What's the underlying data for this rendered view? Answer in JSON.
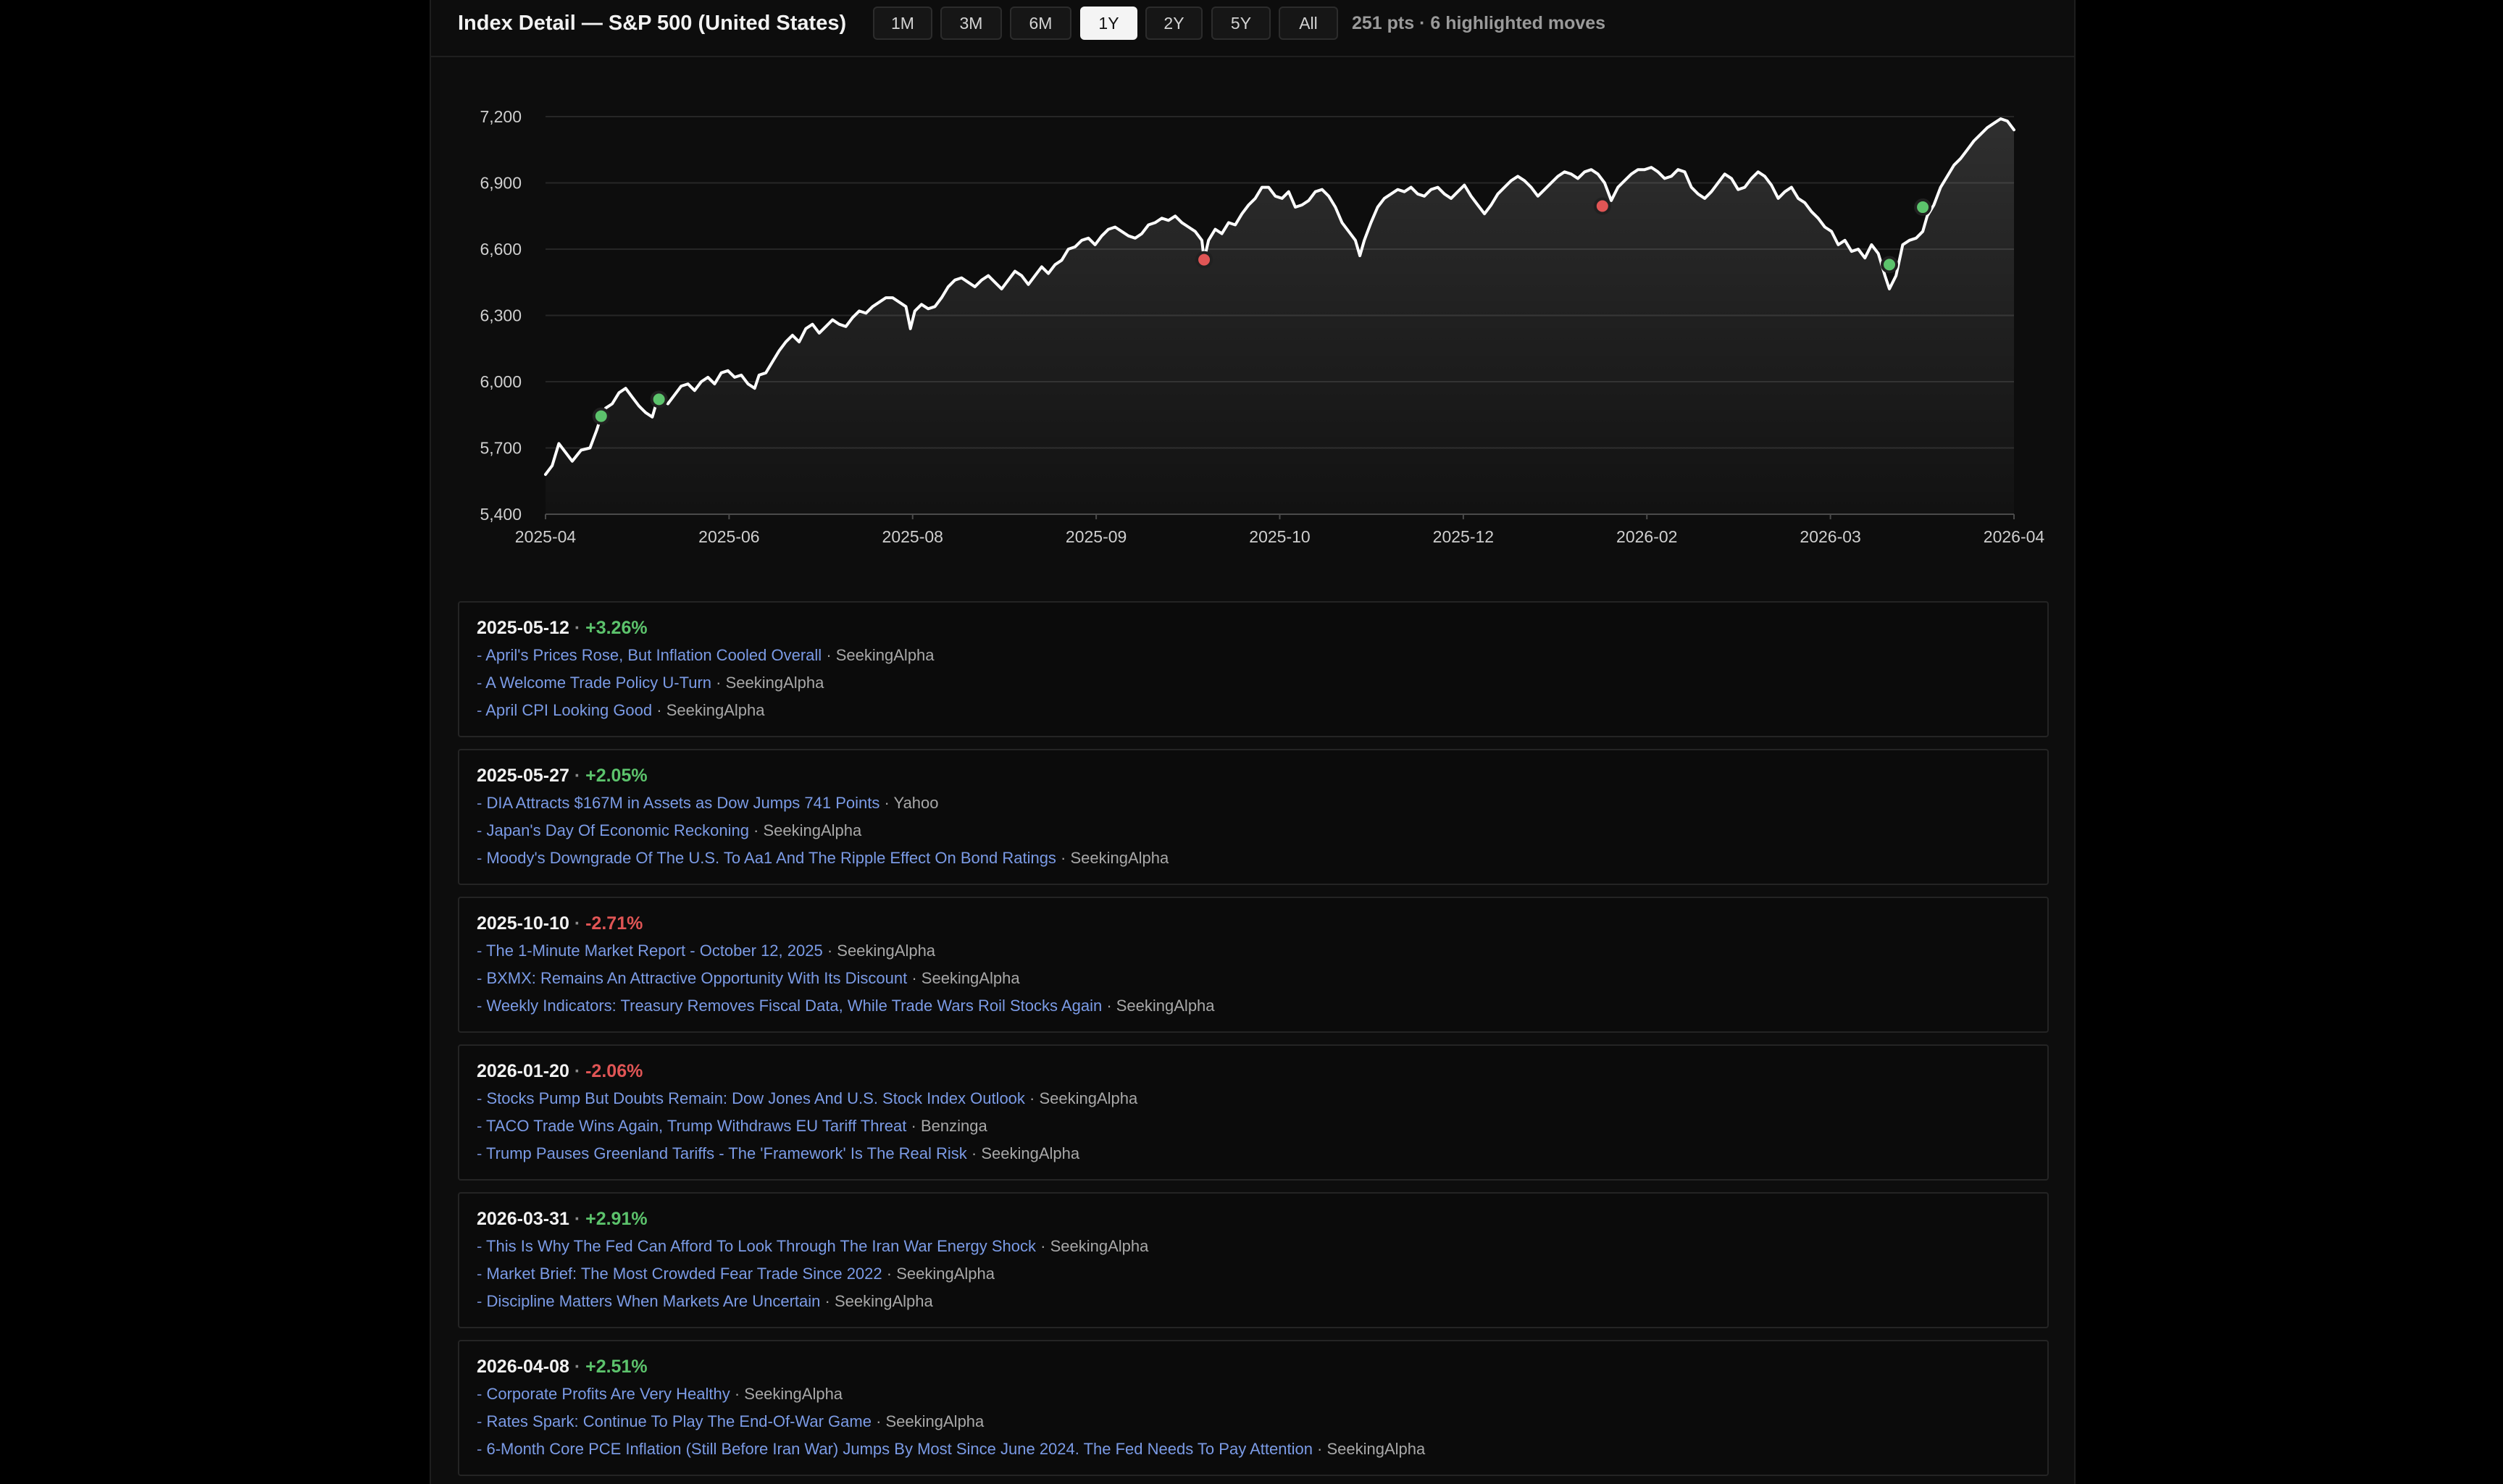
{
  "header": {
    "title": "Index Detail — S&P 500 (United States)",
    "ranges": [
      "1M",
      "3M",
      "6M",
      "1Y",
      "2Y",
      "5Y",
      "All"
    ],
    "active_range": "1Y",
    "summary": "251 pts · 6 highlighted moves"
  },
  "colors": {
    "up": "#5cc36c",
    "down": "#e05555",
    "line": "#ffffff",
    "link": "#7b9be6"
  },
  "chart_data": {
    "type": "line",
    "series": [
      {
        "values": [
          [
            0,
            5580
          ],
          [
            0.3,
            5620
          ],
          [
            0.6,
            5720
          ],
          [
            0.9,
            5680
          ],
          [
            1.2,
            5640
          ],
          [
            1.6,
            5690
          ],
          [
            2.0,
            5700
          ],
          [
            2.3,
            5780
          ],
          [
            2.5,
            5844
          ],
          [
            2.7,
            5880
          ],
          [
            3.0,
            5900
          ],
          [
            3.3,
            5950
          ],
          [
            3.6,
            5970
          ],
          [
            3.9,
            5930
          ],
          [
            4.2,
            5890
          ],
          [
            4.5,
            5860
          ],
          [
            4.8,
            5840
          ],
          [
            5.0,
            5910
          ],
          [
            5.2,
            5920
          ],
          [
            5.5,
            5900
          ],
          [
            5.8,
            5940
          ],
          [
            6.1,
            5980
          ],
          [
            6.4,
            5990
          ],
          [
            6.7,
            5960
          ],
          [
            7.0,
            6000
          ],
          [
            7.3,
            6020
          ],
          [
            7.6,
            5990
          ],
          [
            7.9,
            6040
          ],
          [
            8.2,
            6050
          ],
          [
            8.5,
            6020
          ],
          [
            8.8,
            6030
          ],
          [
            9.1,
            5990
          ],
          [
            9.4,
            5970
          ],
          [
            9.6,
            6030
          ],
          [
            9.9,
            6040
          ],
          [
            10.2,
            6090
          ],
          [
            10.5,
            6140
          ],
          [
            10.8,
            6180
          ],
          [
            11.1,
            6210
          ],
          [
            11.4,
            6180
          ],
          [
            11.7,
            6240
          ],
          [
            12.0,
            6260
          ],
          [
            12.3,
            6220
          ],
          [
            12.6,
            6250
          ],
          [
            12.9,
            6280
          ],
          [
            13.2,
            6260
          ],
          [
            13.5,
            6250
          ],
          [
            13.8,
            6290
          ],
          [
            14.1,
            6320
          ],
          [
            14.4,
            6310
          ],
          [
            14.7,
            6340
          ],
          [
            15.0,
            6360
          ],
          [
            15.3,
            6380
          ],
          [
            15.6,
            6380
          ],
          [
            15.9,
            6360
          ],
          [
            16.2,
            6340
          ],
          [
            16.4,
            6240
          ],
          [
            16.6,
            6320
          ],
          [
            16.9,
            6350
          ],
          [
            17.2,
            6330
          ],
          [
            17.5,
            6340
          ],
          [
            17.8,
            6380
          ],
          [
            18.1,
            6430
          ],
          [
            18.4,
            6460
          ],
          [
            18.7,
            6470
          ],
          [
            19.0,
            6450
          ],
          [
            19.3,
            6430
          ],
          [
            19.6,
            6460
          ],
          [
            19.9,
            6480
          ],
          [
            20.2,
            6450
          ],
          [
            20.5,
            6420
          ],
          [
            20.8,
            6460
          ],
          [
            21.1,
            6500
          ],
          [
            21.4,
            6480
          ],
          [
            21.7,
            6440
          ],
          [
            22.0,
            6480
          ],
          [
            22.3,
            6520
          ],
          [
            22.6,
            6490
          ],
          [
            22.9,
            6530
          ],
          [
            23.2,
            6550
          ],
          [
            23.5,
            6600
          ],
          [
            23.8,
            6610
          ],
          [
            24.1,
            6640
          ],
          [
            24.4,
            6650
          ],
          [
            24.7,
            6620
          ],
          [
            25.0,
            6660
          ],
          [
            25.3,
            6690
          ],
          [
            25.6,
            6700
          ],
          [
            25.9,
            6680
          ],
          [
            26.2,
            6660
          ],
          [
            26.5,
            6650
          ],
          [
            26.8,
            6670
          ],
          [
            27.1,
            6710
          ],
          [
            27.4,
            6720
          ],
          [
            27.7,
            6740
          ],
          [
            28.0,
            6730
          ],
          [
            28.3,
            6750
          ],
          [
            28.6,
            6720
          ],
          [
            28.9,
            6700
          ],
          [
            29.2,
            6680
          ],
          [
            29.5,
            6640
          ],
          [
            29.6,
            6552
          ],
          [
            29.8,
            6640
          ],
          [
            30.1,
            6690
          ],
          [
            30.4,
            6670
          ],
          [
            30.7,
            6720
          ],
          [
            31.0,
            6710
          ],
          [
            31.3,
            6760
          ],
          [
            31.6,
            6800
          ],
          [
            31.9,
            6830
          ],
          [
            32.2,
            6880
          ],
          [
            32.5,
            6880
          ],
          [
            32.8,
            6840
          ],
          [
            33.1,
            6830
          ],
          [
            33.4,
            6860
          ],
          [
            33.7,
            6790
          ],
          [
            34.0,
            6800
          ],
          [
            34.3,
            6820
          ],
          [
            34.6,
            6860
          ],
          [
            34.9,
            6870
          ],
          [
            35.2,
            6840
          ],
          [
            35.5,
            6790
          ],
          [
            35.8,
            6720
          ],
          [
            36.1,
            6680
          ],
          [
            36.4,
            6640
          ],
          [
            36.6,
            6570
          ],
          [
            36.8,
            6640
          ],
          [
            37.1,
            6720
          ],
          [
            37.4,
            6790
          ],
          [
            37.7,
            6830
          ],
          [
            38.0,
            6850
          ],
          [
            38.3,
            6870
          ],
          [
            38.6,
            6860
          ],
          [
            38.9,
            6880
          ],
          [
            39.2,
            6850
          ],
          [
            39.5,
            6840
          ],
          [
            39.8,
            6870
          ],
          [
            40.1,
            6880
          ],
          [
            40.4,
            6850
          ],
          [
            40.7,
            6830
          ],
          [
            41.0,
            6860
          ],
          [
            41.3,
            6890
          ],
          [
            41.6,
            6840
          ],
          [
            41.9,
            6800
          ],
          [
            42.2,
            6760
          ],
          [
            42.5,
            6800
          ],
          [
            42.8,
            6850
          ],
          [
            43.1,
            6880
          ],
          [
            43.4,
            6910
          ],
          [
            43.7,
            6930
          ],
          [
            44.0,
            6910
          ],
          [
            44.3,
            6880
          ],
          [
            44.6,
            6840
          ],
          [
            44.9,
            6870
          ],
          [
            45.2,
            6900
          ],
          [
            45.5,
            6930
          ],
          [
            45.8,
            6950
          ],
          [
            46.1,
            6940
          ],
          [
            46.4,
            6920
          ],
          [
            46.7,
            6950
          ],
          [
            47.0,
            6960
          ],
          [
            47.3,
            6940
          ],
          [
            47.6,
            6900
          ],
          [
            47.9,
            6820
          ],
          [
            48.2,
            6880
          ],
          [
            48.5,
            6910
          ],
          [
            48.8,
            6940
          ],
          [
            49.1,
            6960
          ],
          [
            49.4,
            6960
          ],
          [
            49.7,
            6970
          ],
          [
            50.0,
            6950
          ],
          [
            50.3,
            6920
          ],
          [
            50.6,
            6930
          ],
          [
            50.9,
            6960
          ],
          [
            51.2,
            6950
          ],
          [
            51.5,
            6880
          ],
          [
            51.8,
            6850
          ],
          [
            52.1,
            6830
          ],
          [
            52.4,
            6860
          ],
          [
            52.7,
            6900
          ],
          [
            53.0,
            6940
          ],
          [
            53.3,
            6920
          ],
          [
            53.6,
            6870
          ],
          [
            53.9,
            6880
          ],
          [
            54.2,
            6920
          ],
          [
            54.5,
            6950
          ],
          [
            54.8,
            6930
          ],
          [
            55.1,
            6890
          ],
          [
            55.4,
            6830
          ],
          [
            55.7,
            6860
          ],
          [
            56.0,
            6880
          ],
          [
            56.3,
            6830
          ],
          [
            56.6,
            6810
          ],
          [
            56.9,
            6770
          ],
          [
            57.2,
            6740
          ],
          [
            57.5,
            6700
          ],
          [
            57.8,
            6680
          ],
          [
            58.1,
            6620
          ],
          [
            58.4,
            6640
          ],
          [
            58.7,
            6590
          ],
          [
            59.0,
            6600
          ],
          [
            59.3,
            6560
          ],
          [
            59.6,
            6620
          ],
          [
            59.9,
            6580
          ],
          [
            60.2,
            6480
          ],
          [
            60.4,
            6420
          ],
          [
            60.7,
            6480
          ],
          [
            61.0,
            6620
          ],
          [
            61.3,
            6640
          ],
          [
            61.6,
            6650
          ],
          [
            61.9,
            6680
          ],
          [
            62.1,
            6750
          ],
          [
            62.4,
            6800
          ],
          [
            62.7,
            6880
          ],
          [
            63.0,
            6930
          ],
          [
            63.3,
            6980
          ],
          [
            63.6,
            7010
          ],
          [
            63.9,
            7050
          ],
          [
            64.2,
            7090
          ],
          [
            64.5,
            7120
          ],
          [
            64.8,
            7150
          ],
          [
            65.1,
            7170
          ],
          [
            65.4,
            7190
          ],
          [
            65.7,
            7180
          ],
          [
            66.0,
            7140
          ]
        ]
      }
    ],
    "x_ticks": [
      "2025-04",
      "2025-06",
      "2025-08",
      "2025-09",
      "2025-10",
      "2025-12",
      "2026-02",
      "2026-03",
      "2026-04"
    ],
    "y_ticks": [
      "5,400",
      "5,700",
      "6,000",
      "6,300",
      "6,600",
      "6,900",
      "7,200"
    ],
    "ylim": [
      5400,
      7200
    ],
    "grid": true,
    "markers": [
      {
        "x": 2.5,
        "y": 5844,
        "direction": "up"
      },
      {
        "x": 5.1,
        "y": 5920,
        "direction": "up"
      },
      {
        "x": 29.6,
        "y": 6552,
        "direction": "down"
      },
      {
        "x": 47.5,
        "y": 6795,
        "direction": "down"
      },
      {
        "x": 60.4,
        "y": 6530,
        "direction": "up"
      },
      {
        "x": 61.9,
        "y": 6790,
        "direction": "up"
      }
    ]
  },
  "moves": [
    {
      "date": "2025-05-12",
      "change": "+3.26%",
      "direction": "up",
      "articles": [
        {
          "title": "April's Prices Rose, But Inflation Cooled Overall",
          "source": "SeekingAlpha"
        },
        {
          "title": "A Welcome Trade Policy U-Turn",
          "source": "SeekingAlpha"
        },
        {
          "title": "April CPI Looking Good",
          "source": "SeekingAlpha"
        }
      ]
    },
    {
      "date": "2025-05-27",
      "change": "+2.05%",
      "direction": "up",
      "articles": [
        {
          "title": "DIA Attracts $167M in Assets as Dow Jumps 741 Points",
          "source": "Yahoo"
        },
        {
          "title": "Japan's Day Of Economic Reckoning",
          "source": "SeekingAlpha"
        },
        {
          "title": "Moody's Downgrade Of The U.S. To Aa1 And The Ripple Effect On Bond Ratings",
          "source": "SeekingAlpha"
        }
      ]
    },
    {
      "date": "2025-10-10",
      "change": "-2.71%",
      "direction": "down",
      "articles": [
        {
          "title": "The 1-Minute Market Report - October 12, 2025",
          "source": "SeekingAlpha"
        },
        {
          "title": "BXMX: Remains An Attractive Opportunity With Its Discount",
          "source": "SeekingAlpha"
        },
        {
          "title": "Weekly Indicators: Treasury Removes Fiscal Data, While Trade Wars Roil Stocks Again",
          "source": "SeekingAlpha"
        }
      ]
    },
    {
      "date": "2026-01-20",
      "change": "-2.06%",
      "direction": "down",
      "articles": [
        {
          "title": "Stocks Pump But Doubts Remain: Dow Jones And U.S. Stock Index Outlook",
          "source": "SeekingAlpha"
        },
        {
          "title": "TACO Trade Wins Again, Trump Withdraws EU Tariff Threat",
          "source": "Benzinga"
        },
        {
          "title": "Trump Pauses Greenland Tariffs - The 'Framework' Is The Real Risk",
          "source": "SeekingAlpha"
        }
      ]
    },
    {
      "date": "2026-03-31",
      "change": "+2.91%",
      "direction": "up",
      "articles": [
        {
          "title": "This Is Why The Fed Can Afford To Look Through The Iran War Energy Shock",
          "source": "SeekingAlpha"
        },
        {
          "title": "Market Brief: The Most Crowded Fear Trade Since 2022",
          "source": "SeekingAlpha"
        },
        {
          "title": "Discipline Matters When Markets Are Uncertain",
          "source": "SeekingAlpha"
        }
      ]
    },
    {
      "date": "2026-04-08",
      "change": "+2.51%",
      "direction": "up",
      "articles": [
        {
          "title": "Corporate Profits Are Very Healthy",
          "source": "SeekingAlpha"
        },
        {
          "title": "Rates Spark: Continue To Play The End-Of-War Game",
          "source": "SeekingAlpha"
        },
        {
          "title": "6-Month Core PCE Inflation (Still Before Iran War) Jumps By Most Since June 2024. The Fed Needs To Pay Attention",
          "source": "SeekingAlpha"
        }
      ]
    }
  ]
}
